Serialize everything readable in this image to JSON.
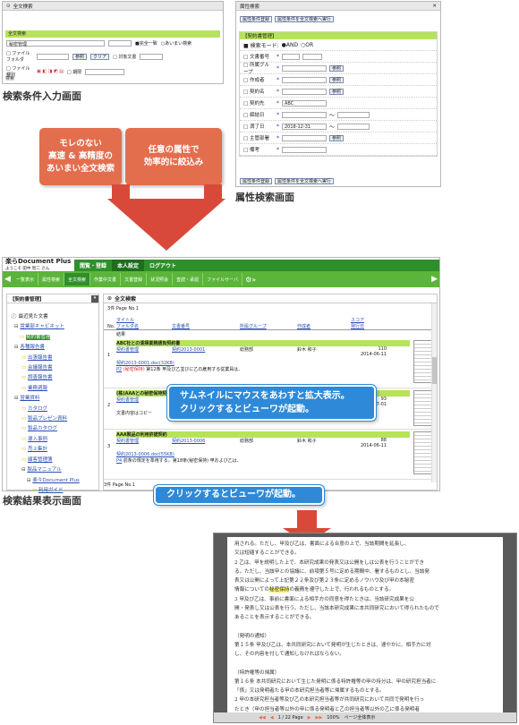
{
  "captions": {
    "search_input": "検索条件入力画面",
    "attr_search": "属性検索画面",
    "results": "検索結果表示画面"
  },
  "callouts": {
    "fulltext": [
      "モレのない",
      "高速 & 高精度の",
      "あいまい全文検索"
    ],
    "attribute": [
      "任意の属性で",
      "効率的に絞込み"
    ],
    "thumbnail": [
      "サムネイルにマウスをあわすと拡大表示。",
      "クリックするとビューワが起動。"
    ],
    "viewer": "クリックするとビューワが起動。"
  },
  "fulltext_window": {
    "title": "全文検索",
    "section": "全文検索",
    "query": "秘密管理",
    "option_and": "■完全一致",
    "option_fuzzy": "○あいまい検索",
    "rows": [
      {
        "label": "□ ファイルフォルダ"
      },
      {
        "label": "□ ファイル種別"
      }
    ],
    "target_label": "□ 対象文書",
    "target2_label": "□ 期限",
    "buttons": [
      "参照",
      "クリア"
    ],
    "footer": "検索"
  },
  "attr_window": {
    "title": "属性検索",
    "buttons": [
      "属性条件登録",
      "属性条件を全文検索へ実行"
    ],
    "section": "【契約書管理】",
    "mode_label": "■ 検索モード:",
    "mode_and": "●AND",
    "mode_or": "○OR",
    "fields": [
      {
        "label": "□ 文書番号",
        "value": ""
      },
      {
        "label": "□ 所属グループ",
        "value": ""
      },
      {
        "label": "□ 作成者",
        "value": ""
      },
      {
        "label": "□ 契約名",
        "value": ""
      },
      {
        "label": "□ 契約先",
        "value": "ABC"
      },
      {
        "label": "□ 締結日",
        "value": ""
      },
      {
        "label": "□ 満了日",
        "value": "2018-12-31"
      },
      {
        "label": "□ 主管部署",
        "value": ""
      },
      {
        "label": "□ 備考",
        "value": ""
      }
    ],
    "ref_label": "参照",
    "bottom_buttons": [
      "属性条件登録",
      "属性条件を全文検索へ実行"
    ]
  },
  "app": {
    "logo": "楽らDocument Plus",
    "user": "ようこそ 田中 智二 さん",
    "menu": [
      "閲覧・登録",
      "本人設定",
      "ログアウト"
    ],
    "toolbar": [
      "一覧表示",
      "属性検索",
      "全文検索",
      "作業中文書",
      "文書登録",
      "状況照会",
      "査読・承認",
      "ファイルサーバ"
    ],
    "sidebar_title": "【契約書管理】",
    "tree": [
      "最近見た文書",
      "営業部キャビネット",
      "契約書管理",
      "各種報告書",
      "出張報告書",
      "会議報告書",
      "調査報告書",
      "業務週報",
      "営業資料",
      "カタログ",
      "製品プレゼン資料",
      "製品カタログ",
      "導入事例",
      "売上集計",
      "顧客管理簿",
      "製品マニュアル",
      "楽々Document Plus",
      "利用ガイド"
    ],
    "panel_title": "全文検索",
    "result_count": "3件 Page No.1",
    "headers": [
      "No.",
      "タイトル",
      "フォルダ名",
      "文書番号",
      "所属グループ",
      "作成者",
      "スコア",
      "発行日",
      "結果"
    ],
    "results": [
      {
        "no": "1",
        "title": "ABC社との清掃業務請負契約書",
        "folder": "契約書管理",
        "docno": "契約2013-0001",
        "group": "総務部",
        "author": "鈴木 和子",
        "score": "110",
        "date": "2014-06-11",
        "file": "契約2013-0001.doc(32KB)",
        "snippet": "第12条 甲及び乙並びに乙の雇用する従業員は、",
        "page": "P2",
        "tag": "(秘密保持)"
      },
      {
        "no": "2",
        "title": "(株)AAAとの秘密保持契約",
        "folder": "契約書管理",
        "docno": "",
        "group": "",
        "author": "",
        "score": "93",
        "date": "2014-07-01",
        "file": "",
        "snippet": "文書内容はコピー",
        "page": "",
        "tag": ""
      },
      {
        "no": "3",
        "title": "AAA製品の利用許諾契約",
        "folder": "契約書管理",
        "docno": "契約2013-0006",
        "group": "総務部",
        "author": "鈴木 和子",
        "score": "88",
        "date": "2014-06-11",
        "file": "契約2013-0006.doc(55KB)",
        "snippet": "前条の規定を準用する。第18条(秘密保持) 甲および乙は、",
        "page": "P4",
        "tag": ""
      }
    ],
    "footer_count": "3件 Page No.1"
  },
  "viewer": {
    "lines": [
      "用される。ただし、甲及び乙は、書面による合意の上で、当該期間を延長し、",
      "又は短縮することができる。",
      "2 乙は、甲を説明した上で、本研究成果の発表又は公開をしは公表を行うことができ",
      "る。ただし、当該甲との協議に、前項第５号に定める期間中、署するものとし、当該発",
      "表又は公開によって上記第２２条及び第２３条に定めるノウハウ及び甲の本秘密",
      "情報についての秘密保持の義務を遵守した上で、行われるものとする。",
      "3 甲及び乙は、事前に書面による相手方の同意を得たときは、当該研究成果を公",
      "開・発表し又は公表を行う。ただし、当該本研究成果に本共同研究において得られたもので",
      "あることを表示することができる。",
      "",
      "（発明の通知）",
      "第１５条 甲及び乙は、本共同研究において発明が生じたときは、速やかに、相手方に対",
      "し、その内容を付して通知しなければならない。",
      "",
      "（特許権等の帰属）",
      "第１６条 本共同研究において生じた発明に係る特許権等の甲の持分は、甲の研究担当者に",
      "「係」又は発明者たる甲の本研究担当者等に帰属するものとする。",
      "2 甲の本研究担当者等及び乙の本研究担当者等が共同研究において共同で発明を行っ",
      "たとき（甲の担当者等以外の甲に係る発明者と乙の担当者等以外の乙に係る発明者",
      "が共同して発明を行ったときを含む。）の特許権等の甲の持分は甲に、乙の持分は乙に"
    ],
    "highlight": "秘密保持",
    "toolbar_text": "1 / 22 Page",
    "toolbar_zoom": "100%",
    "toolbar_mode": "ページ全体表示"
  },
  "colors": {
    "green": "#4aa52e",
    "callout_orange": "#e36e4e",
    "arrow_red": "#d9493a",
    "callout_blue": "#2e8ad8"
  }
}
